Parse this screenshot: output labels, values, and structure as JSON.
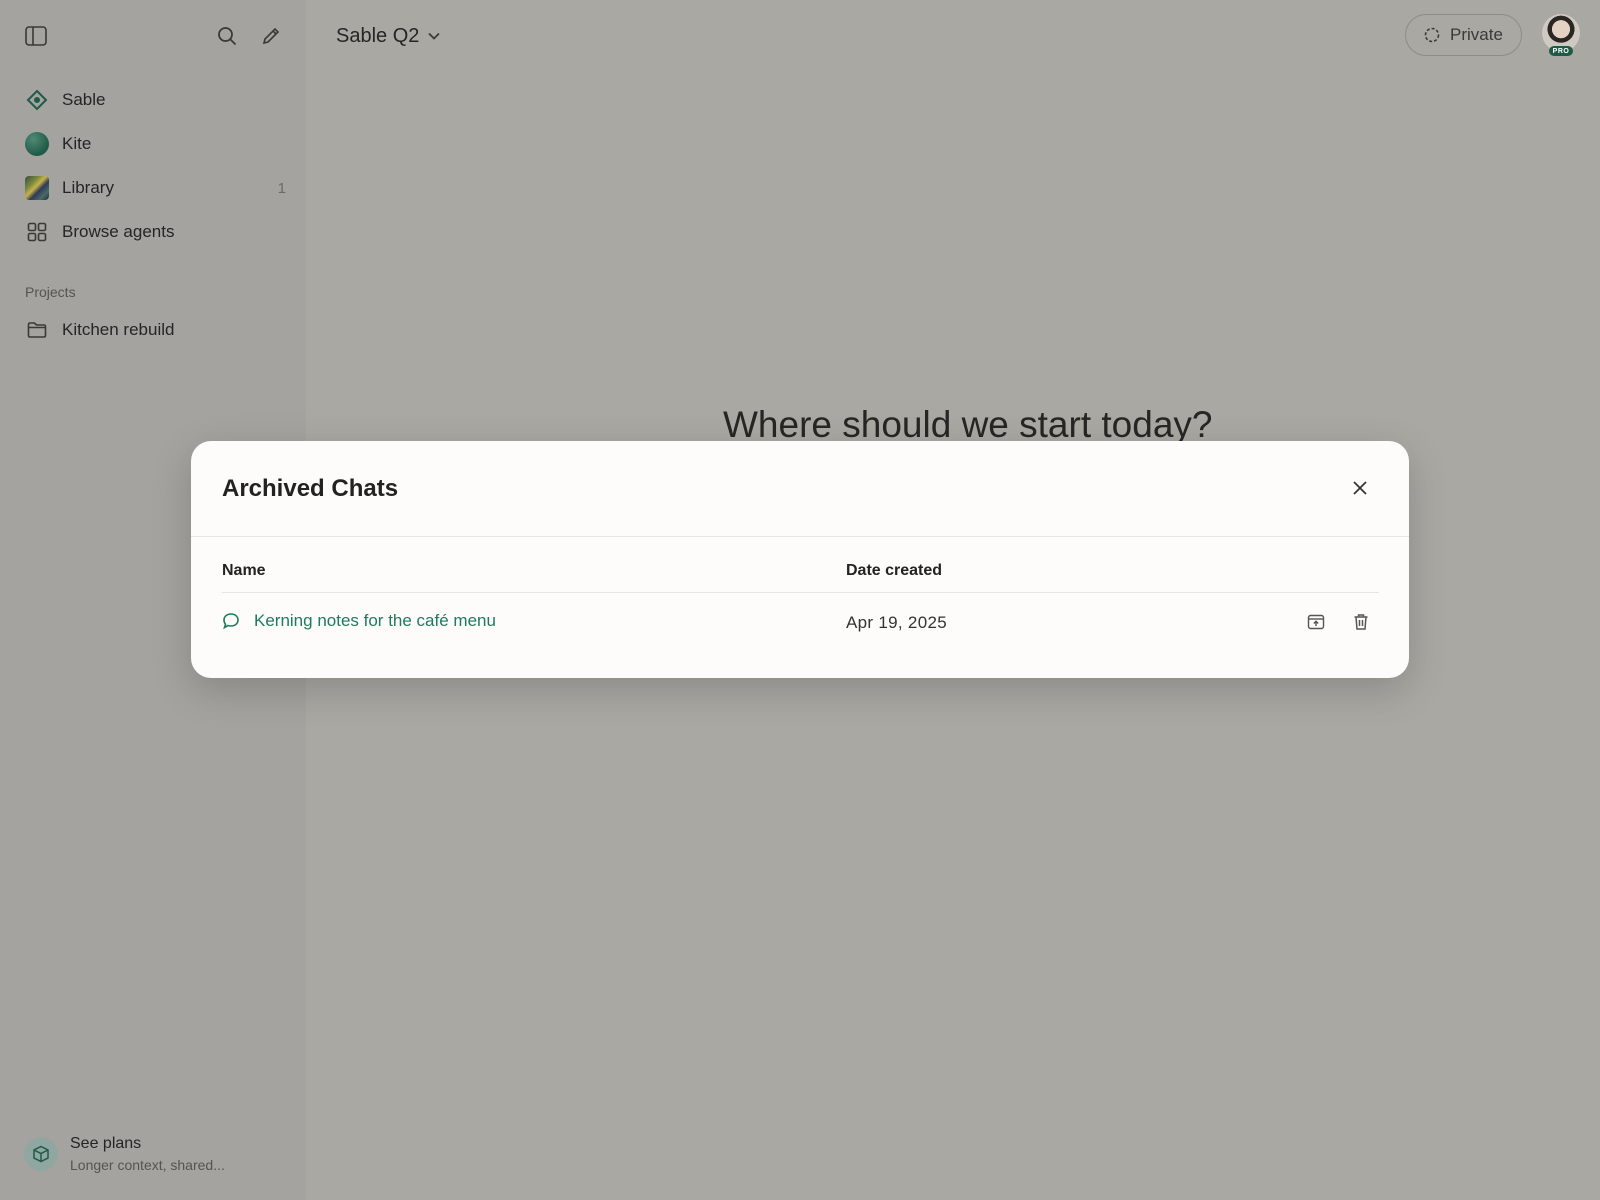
{
  "sidebar": {
    "nav": [
      {
        "label": "Sable",
        "icon": "sable-diamond-icon"
      },
      {
        "label": "Kite",
        "icon": "kite-orb-icon"
      },
      {
        "label": "Library",
        "icon": "library-thumbnail-icon",
        "count": "1"
      },
      {
        "label": "Browse agents",
        "icon": "grid-icon"
      }
    ],
    "projects_label": "Projects",
    "projects": [
      {
        "label": "Kitchen rebuild",
        "icon": "folder-icon"
      }
    ],
    "plans": {
      "title": "See plans",
      "subtitle": "Longer context, shared..."
    }
  },
  "header": {
    "title": "Sable Q2",
    "private_label": "Private",
    "badge": "PRO"
  },
  "main": {
    "greeting": "Where should we start today?"
  },
  "modal": {
    "title": "Archived Chats",
    "columns": {
      "name": "Name",
      "date": "Date created"
    },
    "rows": [
      {
        "name": "Kerning notes for the café menu",
        "date": "Apr 19, 2025"
      }
    ]
  },
  "colors": {
    "accent": "#1f7a60",
    "overlay_bg": "#aaa8a3",
    "modal_bg": "#fdfcfa"
  }
}
